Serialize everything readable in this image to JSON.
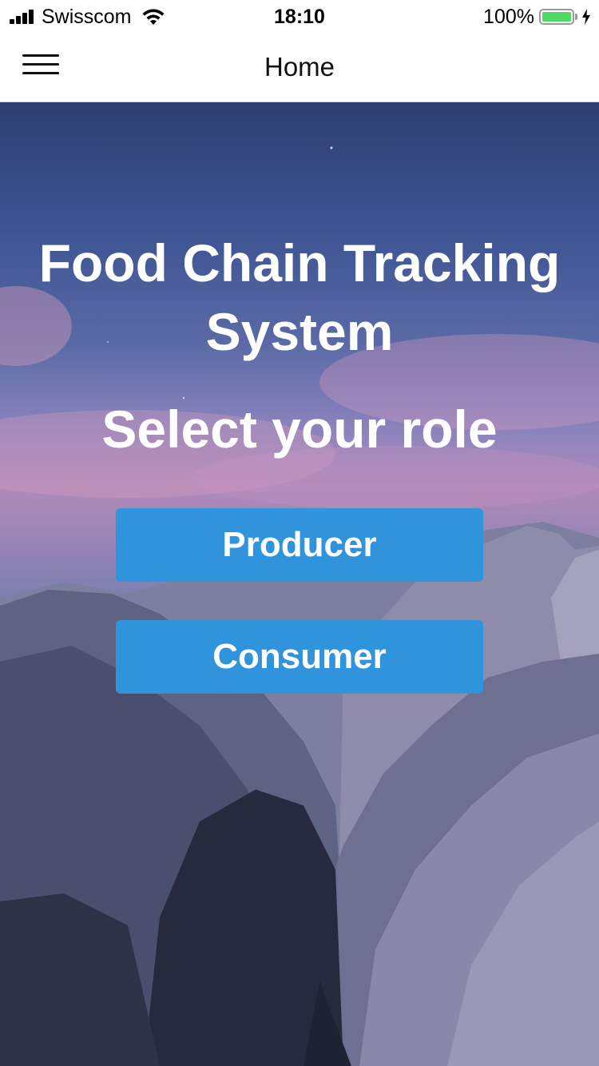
{
  "status_bar": {
    "carrier": "Swisscom",
    "time": "18:10",
    "battery_percent": "100%",
    "battery_level": 1.0,
    "battery_color": "#4cd964"
  },
  "nav": {
    "title": "Home",
    "menu_icon": "hamburger-menu-icon"
  },
  "hero": {
    "title": "Food Chain Tracking System",
    "subtitle": "Select your role",
    "buttons": {
      "producer": "Producer",
      "consumer": "Consumer"
    },
    "button_color": "#3094dc"
  }
}
